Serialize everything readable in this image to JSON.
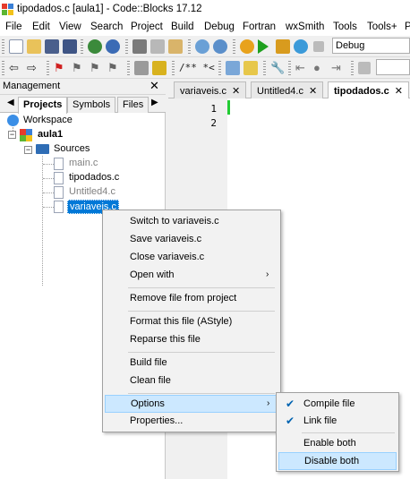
{
  "window": {
    "title": "tipodados.c [aula1] - Code::Blocks 17.12"
  },
  "menubar": [
    "File",
    "Edit",
    "View",
    "Search",
    "Project",
    "Build",
    "Debug",
    "Fortran",
    "wxSmith",
    "Tools",
    "Tools+",
    "P"
  ],
  "toolbar": {
    "build_target": "Debug",
    "comment_text": "/** *<"
  },
  "management": {
    "title": "Management",
    "close": "✕",
    "tabs": [
      "Projects",
      "Symbols",
      "Files"
    ],
    "tree": {
      "workspace": "Workspace",
      "project": "aula1",
      "folder": "Sources",
      "files": [
        "main.c",
        "tipodados.c",
        "Untitled4.c",
        "variaveis.c"
      ]
    }
  },
  "editor": {
    "tabs": [
      "variaveis.c",
      "Untitled4.c",
      "tipodados.c"
    ],
    "tab_close": "✕",
    "line_numbers": [
      "1",
      "2"
    ]
  },
  "context_menu": {
    "items": [
      "Switch to variaveis.c",
      "Save variaveis.c",
      "Close variaveis.c",
      "Open with",
      "Remove file from project",
      "Format this file (AStyle)",
      "Reparse this file",
      "Build file",
      "Clean file",
      "Options",
      "Properties..."
    ],
    "arrow": "›"
  },
  "options_submenu": {
    "items": [
      "Compile file",
      "Link file",
      "Enable both",
      "Disable both"
    ],
    "check": "✔"
  },
  "colors": {
    "highlight": "#cce8ff",
    "selection": "#0078d7",
    "change_bar": "#22cc33"
  }
}
